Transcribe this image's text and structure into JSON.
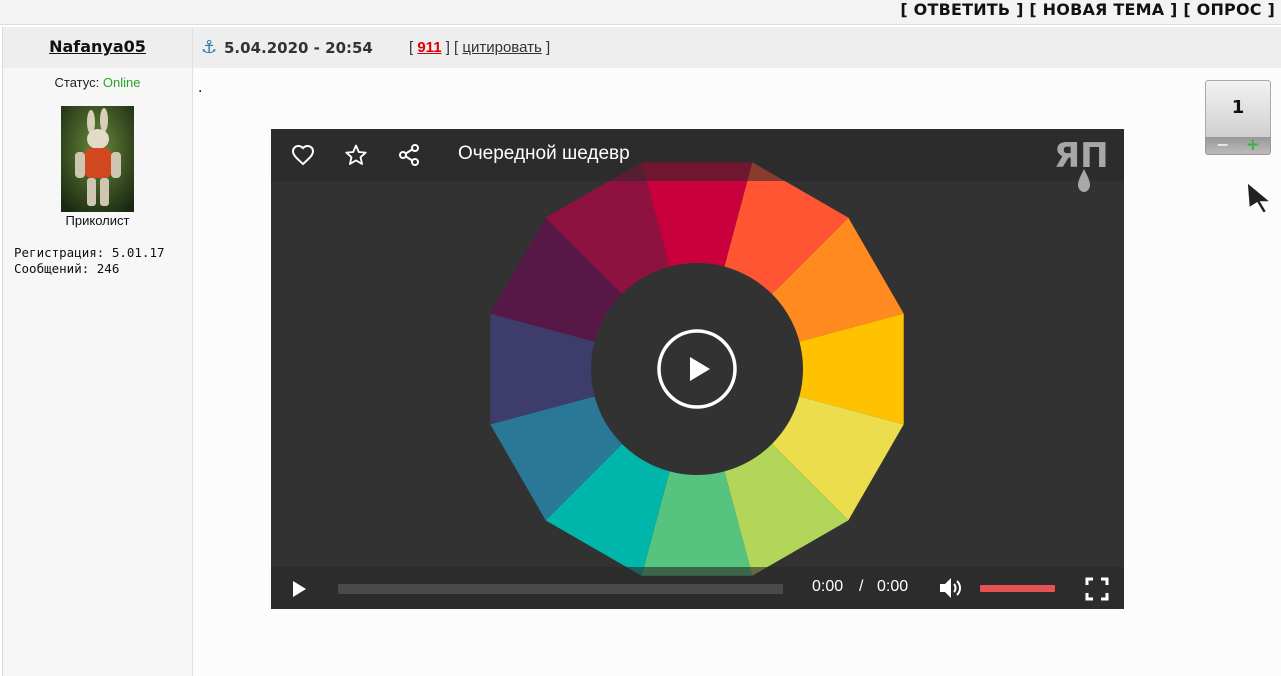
{
  "topbar": {
    "reply": "[ ОТВЕТИТЬ ]",
    "new_topic": "[ НОВАЯ ТЕМА ]",
    "poll": "[ ОПРОС ]"
  },
  "user": {
    "name": "Nafanya05",
    "status_label": "Статус:",
    "status_value": "Online",
    "rank": "Приколист",
    "registration": "Регистрация: 5.01.17",
    "messages": "Сообщений: 246"
  },
  "post": {
    "datetime": "5.04.2020 - 20:54",
    "number": "911",
    "quote_label": "цитировать",
    "body": "."
  },
  "rating": {
    "value": "1",
    "minus": "−",
    "plus": "+"
  },
  "video": {
    "title": "Очередной шедевр",
    "current_time": "0:00",
    "separator": "/",
    "duration": "0:00",
    "progress": 0,
    "volume": 1.0,
    "wheel_colors": [
      "#c8003c",
      "#ff5533",
      "#ff8a1f",
      "#ffc200",
      "#ecdd4c",
      "#b1d65a",
      "#56c47e",
      "#00b6ab",
      "#2a7898",
      "#3e3c6a",
      "#571848",
      "#8f1140"
    ],
    "icons": [
      "heart-icon",
      "star-icon",
      "share-icon",
      "play-icon",
      "volume-icon",
      "fullscreen-icon"
    ]
  }
}
